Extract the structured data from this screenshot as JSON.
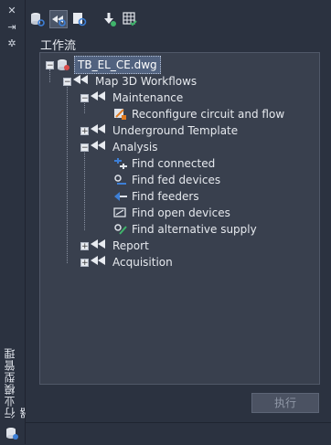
{
  "sidebar": {
    "vertical_title": "行业模型管理器",
    "icons": [
      "close-icon",
      "pin-icon",
      "settings-icon",
      "database-icon"
    ]
  },
  "toolbar": {
    "buttons": [
      "database-search-icon",
      "workflow-play-icon",
      "workflow-refresh-icon",
      "arrow-down-import-icon",
      "grid-check-icon"
    ]
  },
  "section": {
    "label": "工作流"
  },
  "tree": {
    "root": {
      "label": "TB_EL_CE.dwg"
    },
    "workflows": {
      "label": "Map 3D Workflows"
    },
    "maintenance": {
      "label": "Maintenance"
    },
    "reconfigure": {
      "label": "Reconfigure circuit and flow"
    },
    "underground": {
      "label": "Underground Template"
    },
    "analysis": {
      "label": "Analysis"
    },
    "find_connected": {
      "label": "Find connected"
    },
    "find_fed": {
      "label": "Find fed devices"
    },
    "find_feeders": {
      "label": "Find feeders"
    },
    "find_open": {
      "label": "Find open devices"
    },
    "find_alt": {
      "label": "Find alternative supply"
    },
    "report": {
      "label": "Report"
    },
    "acquisition": {
      "label": "Acquisition"
    }
  },
  "run_button": {
    "label": "执行"
  }
}
